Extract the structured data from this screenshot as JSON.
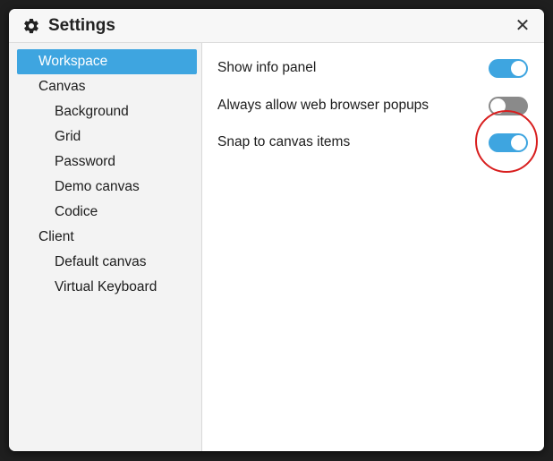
{
  "dialog": {
    "title": "Settings",
    "title_icon": "gear-icon",
    "close_label": "✕",
    "close_icon": "close-icon"
  },
  "sidebar": {
    "items": [
      {
        "label": "Workspace",
        "level": 0,
        "selected": true
      },
      {
        "label": "Canvas",
        "level": 0,
        "selected": false
      },
      {
        "label": "Background",
        "level": 1,
        "selected": false
      },
      {
        "label": "Grid",
        "level": 1,
        "selected": false
      },
      {
        "label": "Password",
        "level": 1,
        "selected": false
      },
      {
        "label": "Demo canvas",
        "level": 1,
        "selected": false
      },
      {
        "label": "Codice",
        "level": 1,
        "selected": false
      },
      {
        "label": "Client",
        "level": 0,
        "selected": false
      },
      {
        "label": "Default canvas",
        "level": 1,
        "selected": false
      },
      {
        "label": "Virtual Keyboard",
        "level": 1,
        "selected": false
      }
    ]
  },
  "settings": [
    {
      "label": "Show info panel",
      "enabled": true
    },
    {
      "label": "Always allow web browser popups",
      "enabled": false
    },
    {
      "label": "Snap to canvas items",
      "enabled": true
    }
  ],
  "colors": {
    "accent": "#3ea5e0",
    "toggle_off": "#8a8a8a",
    "annotation": "#d81e1e",
    "sidebar_bg": "#f3f3f3",
    "titlebar_bg": "#f7f7f7"
  }
}
